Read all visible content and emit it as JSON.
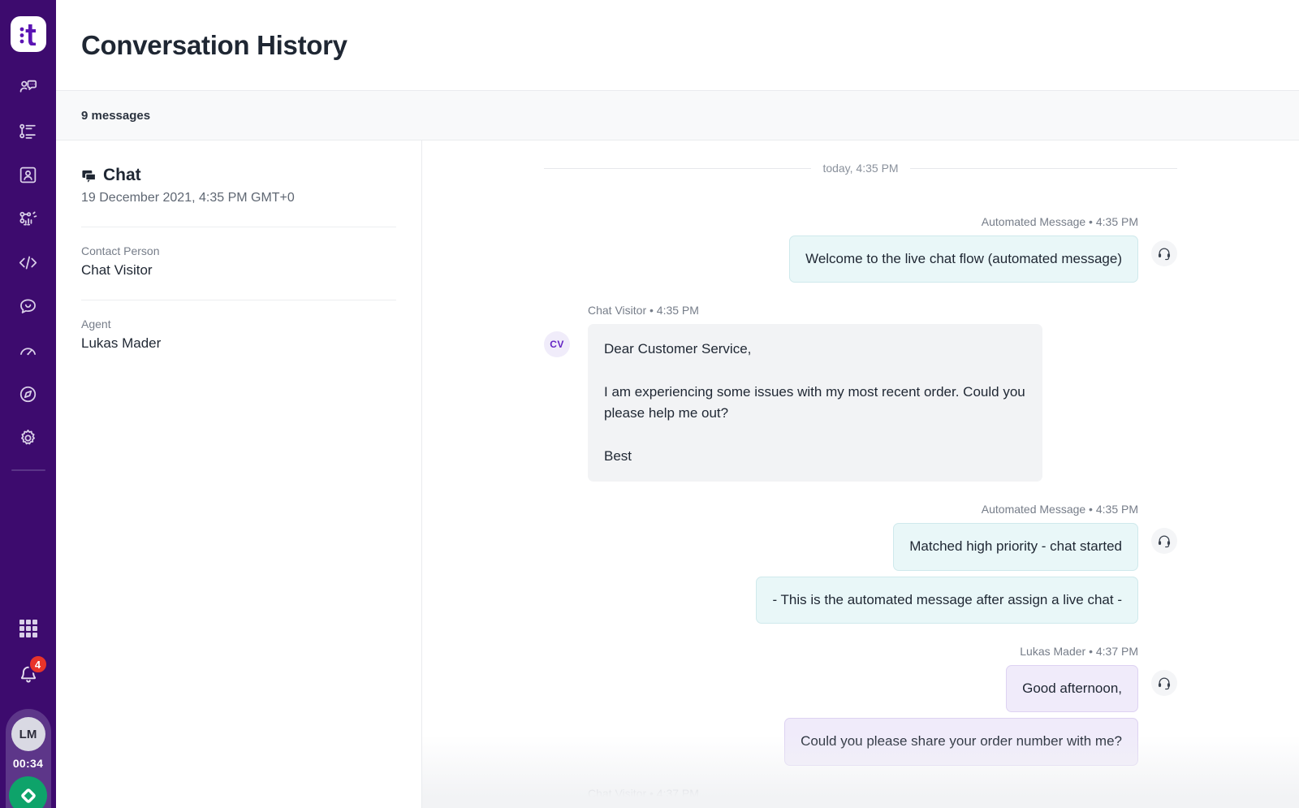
{
  "brand": {
    "logo_text": ":t",
    "accent": "#5b14b4",
    "rail_bg": "#3d0b6e"
  },
  "rail": {
    "items": [
      {
        "icon": "chat-support-icon",
        "name": "sidebar-item-conversations"
      },
      {
        "icon": "task-list-icon",
        "name": "sidebar-item-tasks"
      },
      {
        "icon": "contact-card-icon",
        "name": "sidebar-item-contacts"
      },
      {
        "icon": "workflow-icon",
        "name": "sidebar-item-automation"
      },
      {
        "icon": "code-icon",
        "name": "sidebar-item-developer"
      },
      {
        "icon": "speech-bubble-icon",
        "name": "sidebar-item-messages"
      },
      {
        "icon": "gauge-icon",
        "name": "sidebar-item-performance"
      },
      {
        "icon": "compass-icon",
        "name": "sidebar-item-explore"
      },
      {
        "icon": "gear-icon",
        "name": "sidebar-item-settings"
      }
    ],
    "apps_icon": "grid-apps-icon",
    "notifications": {
      "icon": "bell-icon",
      "badge": "4"
    },
    "user": {
      "initials": "LM",
      "timer": "00:34",
      "status_icon": "diamond-status-icon",
      "status_color": "#0ea36a"
    }
  },
  "header": {
    "title": "Conversation History"
  },
  "subheader": {
    "message_count": "9 messages"
  },
  "detail": {
    "channel_icon": "chat-bubbles-icon",
    "channel": "Chat",
    "datetime": "19 December 2021, 4:35 PM GMT+0",
    "fields": [
      {
        "label": "Contact Person",
        "value": "Chat Visitor"
      },
      {
        "label": "Agent",
        "value": "Lukas Mader"
      }
    ]
  },
  "conversation": {
    "day_divider": "today, 4:35 PM",
    "headset_icon": "headset-icon",
    "groups": [
      {
        "meta": "Automated Message • 4:35 PM",
        "side": "right",
        "kind": "auto",
        "bubbles": [
          "Welcome to the live chat flow (automated message)"
        ]
      },
      {
        "meta": "Chat Visitor • 4:35 PM",
        "side": "left",
        "kind": "visitor",
        "avatar": "CV",
        "bubbles": [
          "Dear Customer Service,\n\nI am experiencing some issues with my most recent order. Could you please help me out?\n\nBest"
        ]
      },
      {
        "meta": "Automated Message • 4:35 PM",
        "side": "right",
        "kind": "auto",
        "bubbles": [
          "Matched high priority - chat started",
          "- This is the automated message after assign a live chat -"
        ]
      },
      {
        "meta": "Lukas Mader • 4:37 PM",
        "side": "right",
        "kind": "agent",
        "bubbles": [
          "Good afternoon,",
          "Could you please share your order number with me?"
        ]
      },
      {
        "meta": "Chat Visitor • 4:37 PM",
        "side": "left",
        "kind": "visitor",
        "avatar": "",
        "bubbles": []
      }
    ]
  }
}
